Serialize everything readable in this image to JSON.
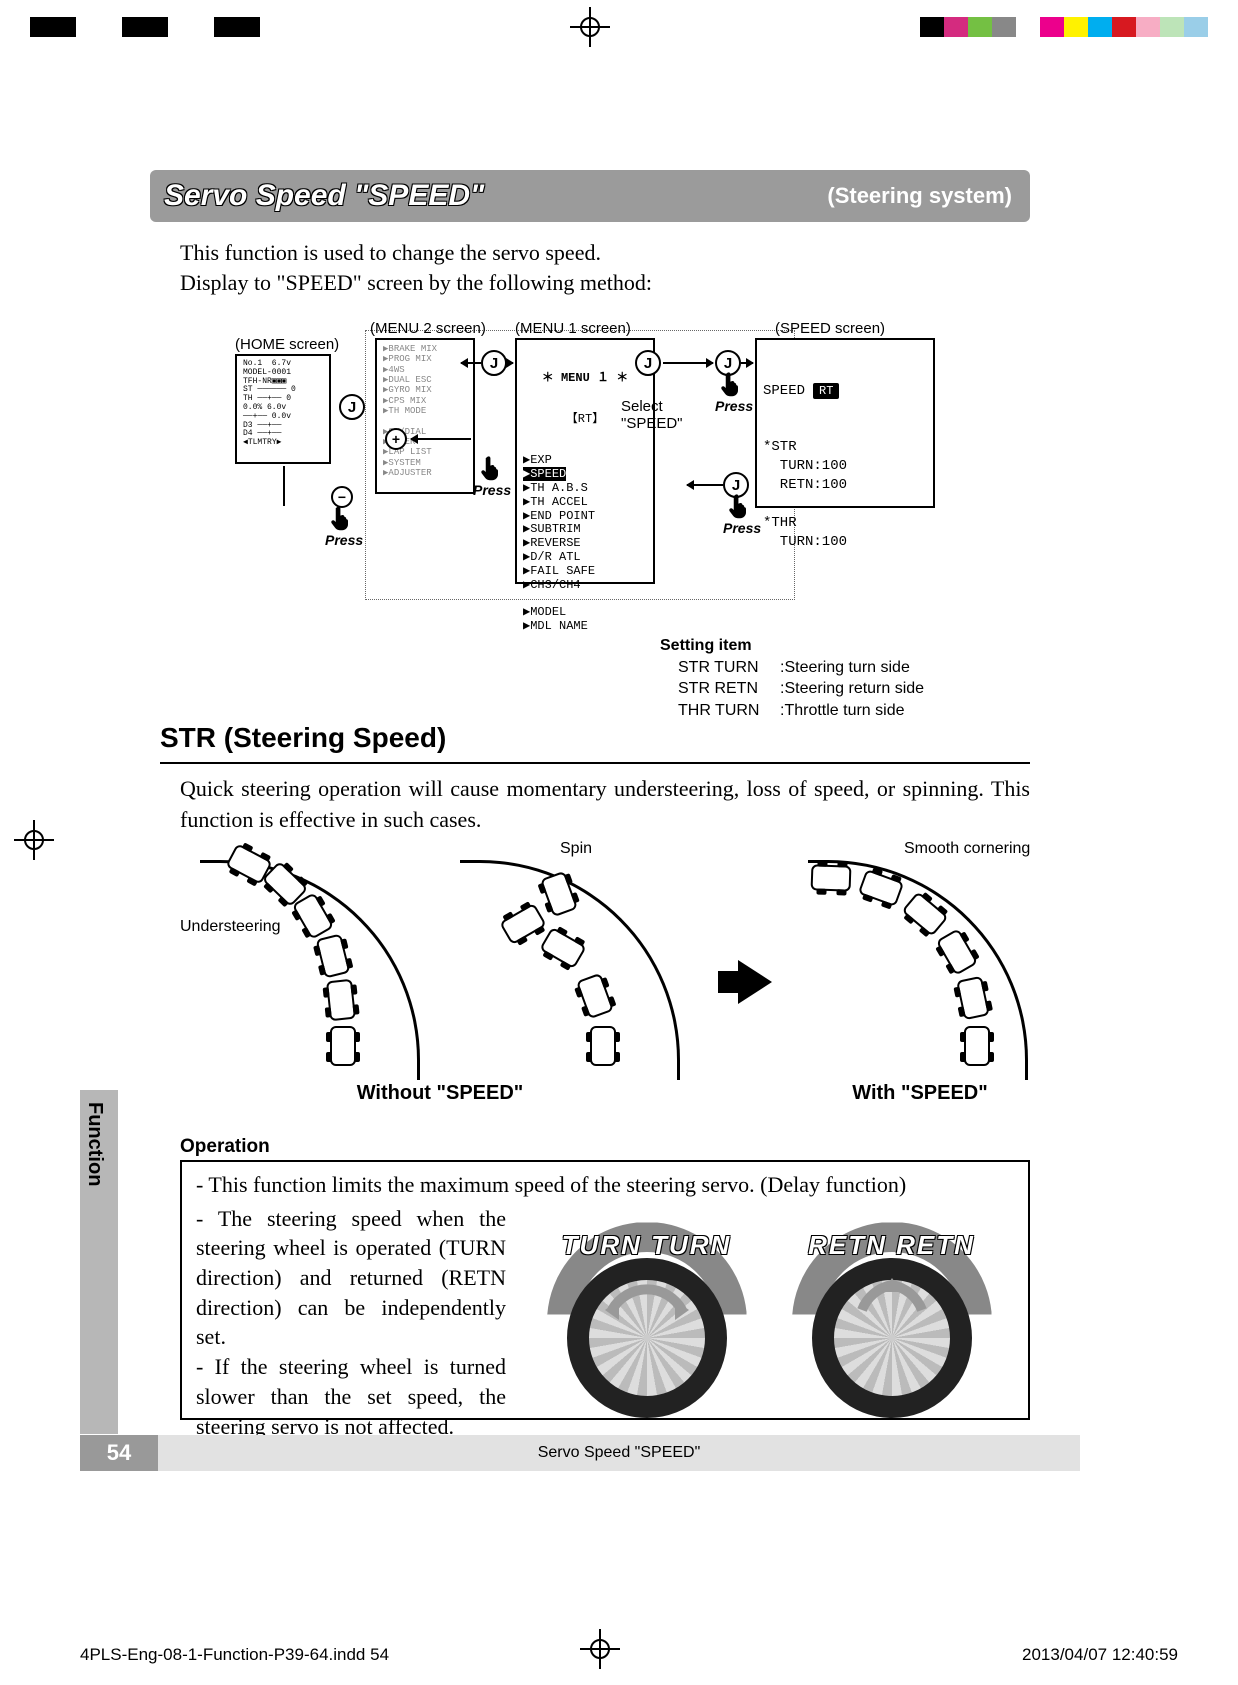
{
  "header": {
    "title": "Servo Speed \"SPEED\"",
    "subtitle": "(Steering system)"
  },
  "intro": {
    "line1": "This function is used to change the servo speed.",
    "line2": "Display to \"SPEED\" screen by the following method:"
  },
  "nav": {
    "home_label": "(HOME screen)",
    "menu2_label": "(MENU 2 screen)",
    "menu1_label": "(MENU 1 screen)",
    "speed_label": "(SPEED screen)",
    "select_text": "Select \"SPEED\"",
    "btn_j": "J",
    "btn_plus": "+",
    "btn_minus": "−",
    "press": "Press",
    "menu1_title": "＊ MENU １ ＊",
    "menu1_rt": "【RT】",
    "menu1_items": "▶EXP\n▶SPEED\n▶TH A.B.S\n▶TH ACCEL\n▶END POINT\n▶SUBTRIM\n▶REVERSE\n▶D/R ATL\n▶FAIL SAFE\n▶CH3/CH4\n\n▶MODEL\n▶MDL NAME",
    "menu2_items": "▶BRAKE MIX\n▶PROG MIX\n▶4WS\n▶DUAL ESC\n▶GYRO MIX\n▶CPS MIX\n▶TH MODE\n\n▶SW/DIAL\n▶TIMER\n▶LAP LIST\n▶SYSTEM\n▶ADJUSTER",
    "speed_screen_title": "SPEED",
    "speed_screen_tag": "RT",
    "speed_screen_body": "*STR\n  TURN:100\n  RETN:100\n\n*THR\n  TURN:100"
  },
  "setting": {
    "header": "Setting item",
    "rows": [
      {
        "k": "STR TURN",
        "v": ":Steering turn side"
      },
      {
        "k": "STR RETN",
        "v": ":Steering return side"
      },
      {
        "k": "THR TURN",
        "v": ":Throttle turn side"
      }
    ]
  },
  "str": {
    "heading": "STR (Steering Speed)",
    "intro": "Quick steering operation will cause momentary understeering, loss of speed, or spinning. This function is effective in such cases.",
    "labels": {
      "understeer": "Understeering",
      "spin": "Spin",
      "smooth": "Smooth cornering",
      "without": "Without \"SPEED\"",
      "with": "With \"SPEED\""
    }
  },
  "operation": {
    "header": "Operation",
    "line_full": "- This function limits the maximum speed of the steering servo. (Delay function)",
    "para1": "- The steering speed when the steering wheel is operated (TURN direction) and returned (RETN direction) can be independently set.",
    "para2": "- If the steering wheel is turned slower than the set speed, the steering servo is not affected.",
    "wheel_turn": "TURN  TURN",
    "wheel_retn": "RETN  RETN"
  },
  "side_tab": "Function",
  "page_number": "54",
  "footer_title": "Servo Speed \"SPEED\"",
  "print_slug": "4PLS-Eng-08-1-Function-P39-64.indd   54",
  "print_ts": "2013/04/07   12:40:59",
  "reg_colors": [
    "#000",
    "#d42b7f",
    "#74c043",
    "#888",
    "#fff",
    "#ec008c",
    "#fff200",
    "#00aeef",
    "#d71920",
    "#f7adc4",
    "#bde4b8",
    "#9acee8"
  ]
}
